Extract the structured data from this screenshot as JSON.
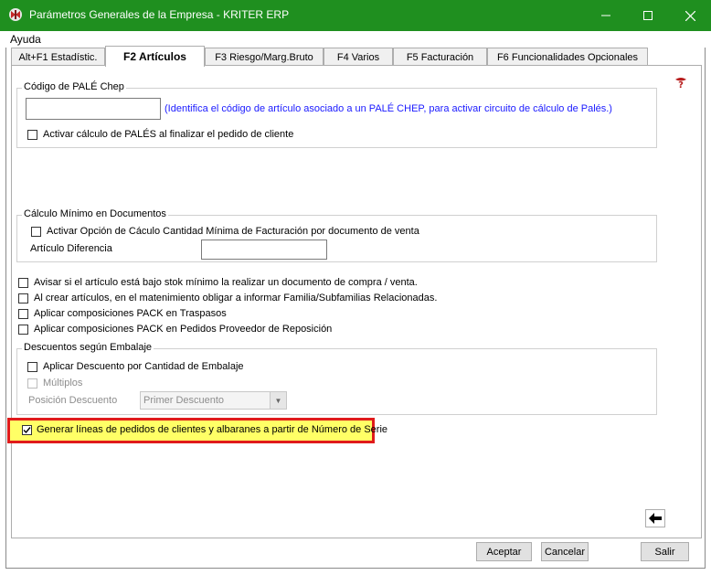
{
  "window": {
    "title": "Parámetros Generales de la Empresa - KRITER ERP",
    "title_bar_color": "#1f8f1f",
    "app_icon": "kriter-logo-icon",
    "controls": [
      "minimize-icon",
      "maximize-icon",
      "close-icon"
    ]
  },
  "menu": {
    "items": [
      "Ayuda"
    ]
  },
  "tabs": [
    {
      "label": "Alt+F1 Estadístic.",
      "active": false
    },
    {
      "label": "F2 Artículos",
      "active": true
    },
    {
      "label": "F3 Riesgo/Marg.Bruto",
      "active": false
    },
    {
      "label": "F4 Varios",
      "active": false
    },
    {
      "label": "F5 Facturación",
      "active": false
    },
    {
      "label": "F6 Funcionalidades Opcionales",
      "active": false
    }
  ],
  "pale": {
    "legend": "Código de PALÉ Chep",
    "code_value": "",
    "hint": "(Identifica el código de artículo asociado a un PALÉ CHEP, para activar circuito de cálculo de Palés.)",
    "activate_label": "Activar cálculo de PALÉS al finalizar el pedido de cliente",
    "activate_checked": false
  },
  "minimo": {
    "legend": "Cálculo Mínimo en Documentos",
    "option_label": "Activar Opción de Cáculo Cantidad Mínima de Facturación por documento de venta",
    "option_checked": false,
    "articulo_label": "Artículo Diferencia",
    "articulo_value": ""
  },
  "options": [
    {
      "label": "Avisar si el artículo está bajo stok mínimo la realizar un documento de compra / venta.",
      "checked": false
    },
    {
      "label": "Al crear artículos, en el matenimiento obligar a informar Familia/Subfamilias Relacionadas.",
      "checked": false
    },
    {
      "label": "Aplicar composiciones PACK en Traspasos",
      "checked": false
    },
    {
      "label": "Aplicar composiciones PACK en Pedidos Proveedor de Reposición",
      "checked": false
    }
  ],
  "descuentos": {
    "legend": "Descuentos según Embalaje",
    "aplicar_label": "Aplicar Descuento por Cantidad de Embalaje",
    "aplicar_checked": false,
    "multiplos_label": "Múltiplos",
    "multiplos_checked": false,
    "posicion_label": "Posición Descuento",
    "posicion_value": "Primer Descuento"
  },
  "serie": {
    "label": "Generar líneas de pedidos de clientes y albaranes a partir de Número de Serie",
    "checked": true,
    "highlight_border": "#e01b1b",
    "highlight_fill": "#ffff66"
  },
  "help_icon": "help-icon",
  "back_icon": "back-arrow-icon",
  "buttons": {
    "aceptar": "Aceptar",
    "cancelar": "Cancelar",
    "salir": "Salir"
  }
}
